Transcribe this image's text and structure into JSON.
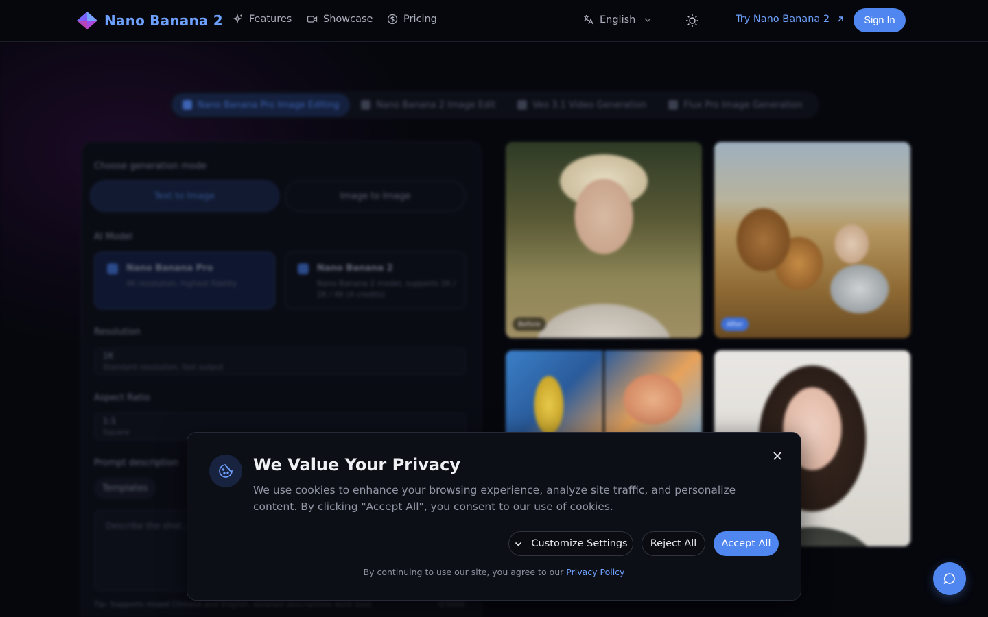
{
  "header": {
    "brand": "Nano Banana 2",
    "nav": [
      {
        "label": "Features",
        "icon": "sparkles-icon"
      },
      {
        "label": "Showcase",
        "icon": "video-camera-icon"
      },
      {
        "label": "Pricing",
        "icon": "dollar-circle-icon"
      }
    ],
    "language": "English",
    "try_link": "Try Nano Banana 2",
    "sign_in": "Sign In"
  },
  "background": {
    "tabs": [
      "Nano Banana Pro Image Editing",
      "Nano Banana 2 Image Edit",
      "Veo 3.1 Video Generation",
      "Flux Pro Image Generation"
    ],
    "form": {
      "mode_label": "Choose generation mode",
      "modes": [
        "Text to Image",
        "Image to Image"
      ],
      "model_label": "AI Model",
      "models": [
        {
          "title": "Nano Banana Pro",
          "desc": "4K resolution, highest fidelity"
        },
        {
          "title": "Nano Banana 2",
          "desc": "Nano Banana 2 model, supports 1K / 2K / 4K (4 credits)"
        }
      ],
      "resolution_label": "Resolution",
      "resolution_value": "1K",
      "resolution_sub": "Standard resolution, fast output",
      "aspect_label": "Aspect Ratio",
      "aspect_value": "1:1",
      "aspect_sub": "Square",
      "prompt_label": "Prompt description",
      "templates_chip": "Templates",
      "prompt_placeholder": "Describe the shot...",
      "tip": "Tip: Supports mixed Chinese and English, detailed descriptions work best",
      "char_count": "0/5000"
    },
    "gallery_tags": {
      "before": "Before",
      "after": "After"
    }
  },
  "cookie": {
    "title": "We Value Your Privacy",
    "text": "We use cookies to enhance your browsing experience, analyze site traffic, and personalize content. By clicking \"Accept All\", you consent to our use of cookies.",
    "customize": "Customize Settings",
    "reject": "Reject All",
    "accept": "Accept All",
    "footer_prefix": "By continuing to use our site, you agree to our",
    "privacy_link": "Privacy Policy"
  },
  "colors": {
    "accent": "#4f86f0",
    "brand_text": "#6ea1ff",
    "background": "#07080f"
  }
}
